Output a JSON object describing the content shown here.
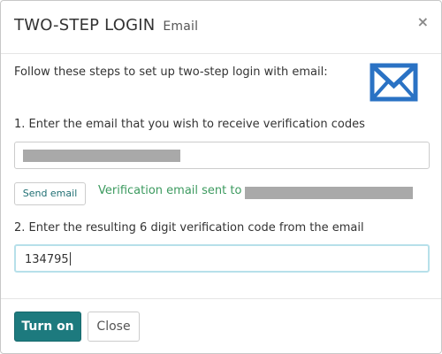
{
  "dialog": {
    "title": "TWO-STEP LOGIN",
    "subtitle": "Email",
    "close_glyph": "×"
  },
  "body": {
    "intro": "Follow these steps to set up two-step login with email:",
    "icon": "envelope-icon",
    "step1_label": "1. Enter the email that you wish to receive verification codes",
    "send_button": "Send email",
    "sent_message": "Verification email sent to",
    "step2_label": "2. Enter the resulting 6 digit verification code from the email",
    "code_value": "134795"
  },
  "footer": {
    "turn_on_label": "Turn on",
    "close_label": "Close"
  },
  "colors": {
    "primary": "#1d7a7e",
    "success_text": "#3c9a5f",
    "icon_blue": "#2a72c4",
    "focus_border": "#b7e0ea"
  }
}
